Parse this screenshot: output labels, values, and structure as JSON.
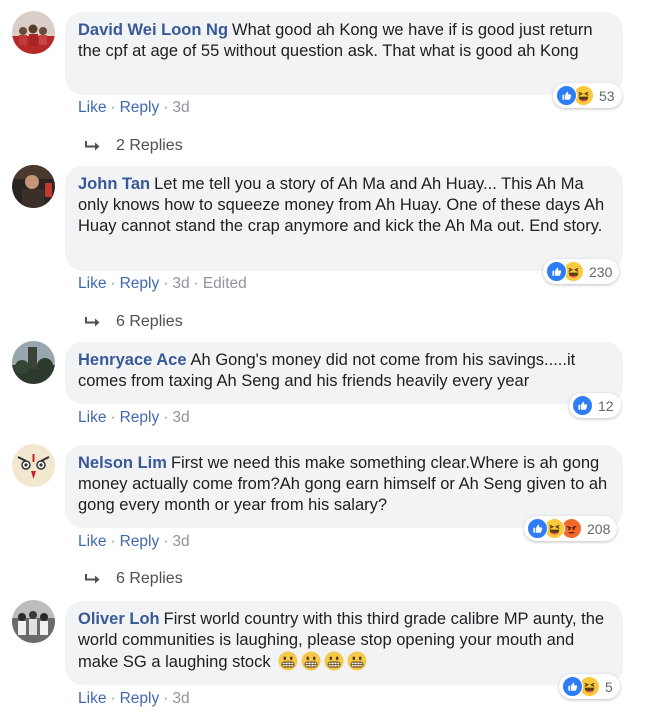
{
  "comments": [
    {
      "author": "David Wei Loon Ng",
      "text": "What good ah Kong we have if is good just return the cpf at age of 55 without question ask. That what is good ah Kong",
      "actions": {
        "like": "Like",
        "reply": "Reply",
        "time": "3d"
      },
      "reaction_count": "53",
      "reactions": [
        "like-icon",
        "haha-icon"
      ],
      "replies_label": "2 Replies"
    },
    {
      "author": "John Tan",
      "text": "Let me tell you a story of Ah Ma and Ah Huay... This Ah Ma only knows how to squeeze money from Ah Huay. One of these days Ah Huay cannot stand the crap anymore and kick the Ah Ma out. End story.",
      "actions": {
        "like": "Like",
        "reply": "Reply",
        "time": "3d",
        "edited": "Edited"
      },
      "reaction_count": "230",
      "reactions": [
        "like-icon",
        "haha-icon"
      ],
      "replies_label": "6 Replies"
    },
    {
      "author": "Henryace Ace",
      "text": "Ah Gong's money did not come from his savings.....it comes from taxing Ah Seng and his friends heavily every year",
      "actions": {
        "like": "Like",
        "reply": "Reply",
        "time": "3d"
      },
      "reaction_count": "12",
      "reactions": [
        "like-icon"
      ]
    },
    {
      "author": "Nelson Lim",
      "text": "First we need this make something clear.Where is ah gong money actually come from?Ah gong earn himself or Ah Seng given to ah gong every month or year from his salary?",
      "actions": {
        "like": "Like",
        "reply": "Reply",
        "time": "3d"
      },
      "reaction_count": "208",
      "reactions": [
        "like-icon",
        "haha-icon",
        "angry-icon"
      ],
      "replies_label": "6 Replies"
    },
    {
      "author": "Oliver Loh",
      "text": "First world country with this third grade calibre MP aunty, the world communities is laughing, please stop opening your mouth and make SG a laughing stock",
      "emoji": [
        "grinning-face-icon",
        "grinning-face-icon",
        "grinning-face-icon",
        "grinning-face-icon"
      ],
      "actions": {
        "like": "Like",
        "reply": "Reply",
        "time": "3d"
      },
      "reaction_count": "5",
      "reactions": [
        "like-icon",
        "haha-icon"
      ]
    }
  ],
  "colors": {
    "author": "#385898",
    "link": "#4267b2",
    "bubble": "#f2f3f5",
    "like": "#2e7cf6",
    "haha": "#f8c93d",
    "angry": "#f16a2c"
  }
}
